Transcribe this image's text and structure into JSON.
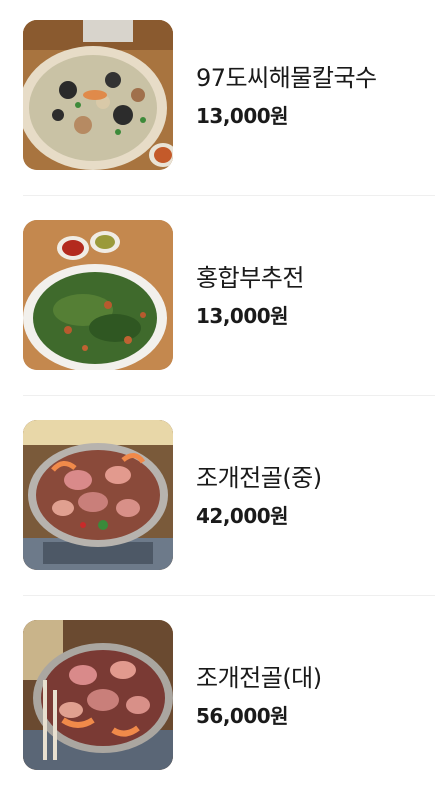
{
  "menu": {
    "items": [
      {
        "name": "97도씨해물칼국수",
        "price": "13,000원",
        "photo": "seafood-kalguksu-photo"
      },
      {
        "name": "홍합부추전",
        "price": "13,000원",
        "photo": "mussel-chive-pancake-photo"
      },
      {
        "name": "조개전골(중)",
        "price": "42,000원",
        "photo": "clam-hotpot-medium-photo"
      },
      {
        "name": "조개전골(대)",
        "price": "56,000원",
        "photo": "clam-hotpot-large-photo"
      }
    ]
  }
}
